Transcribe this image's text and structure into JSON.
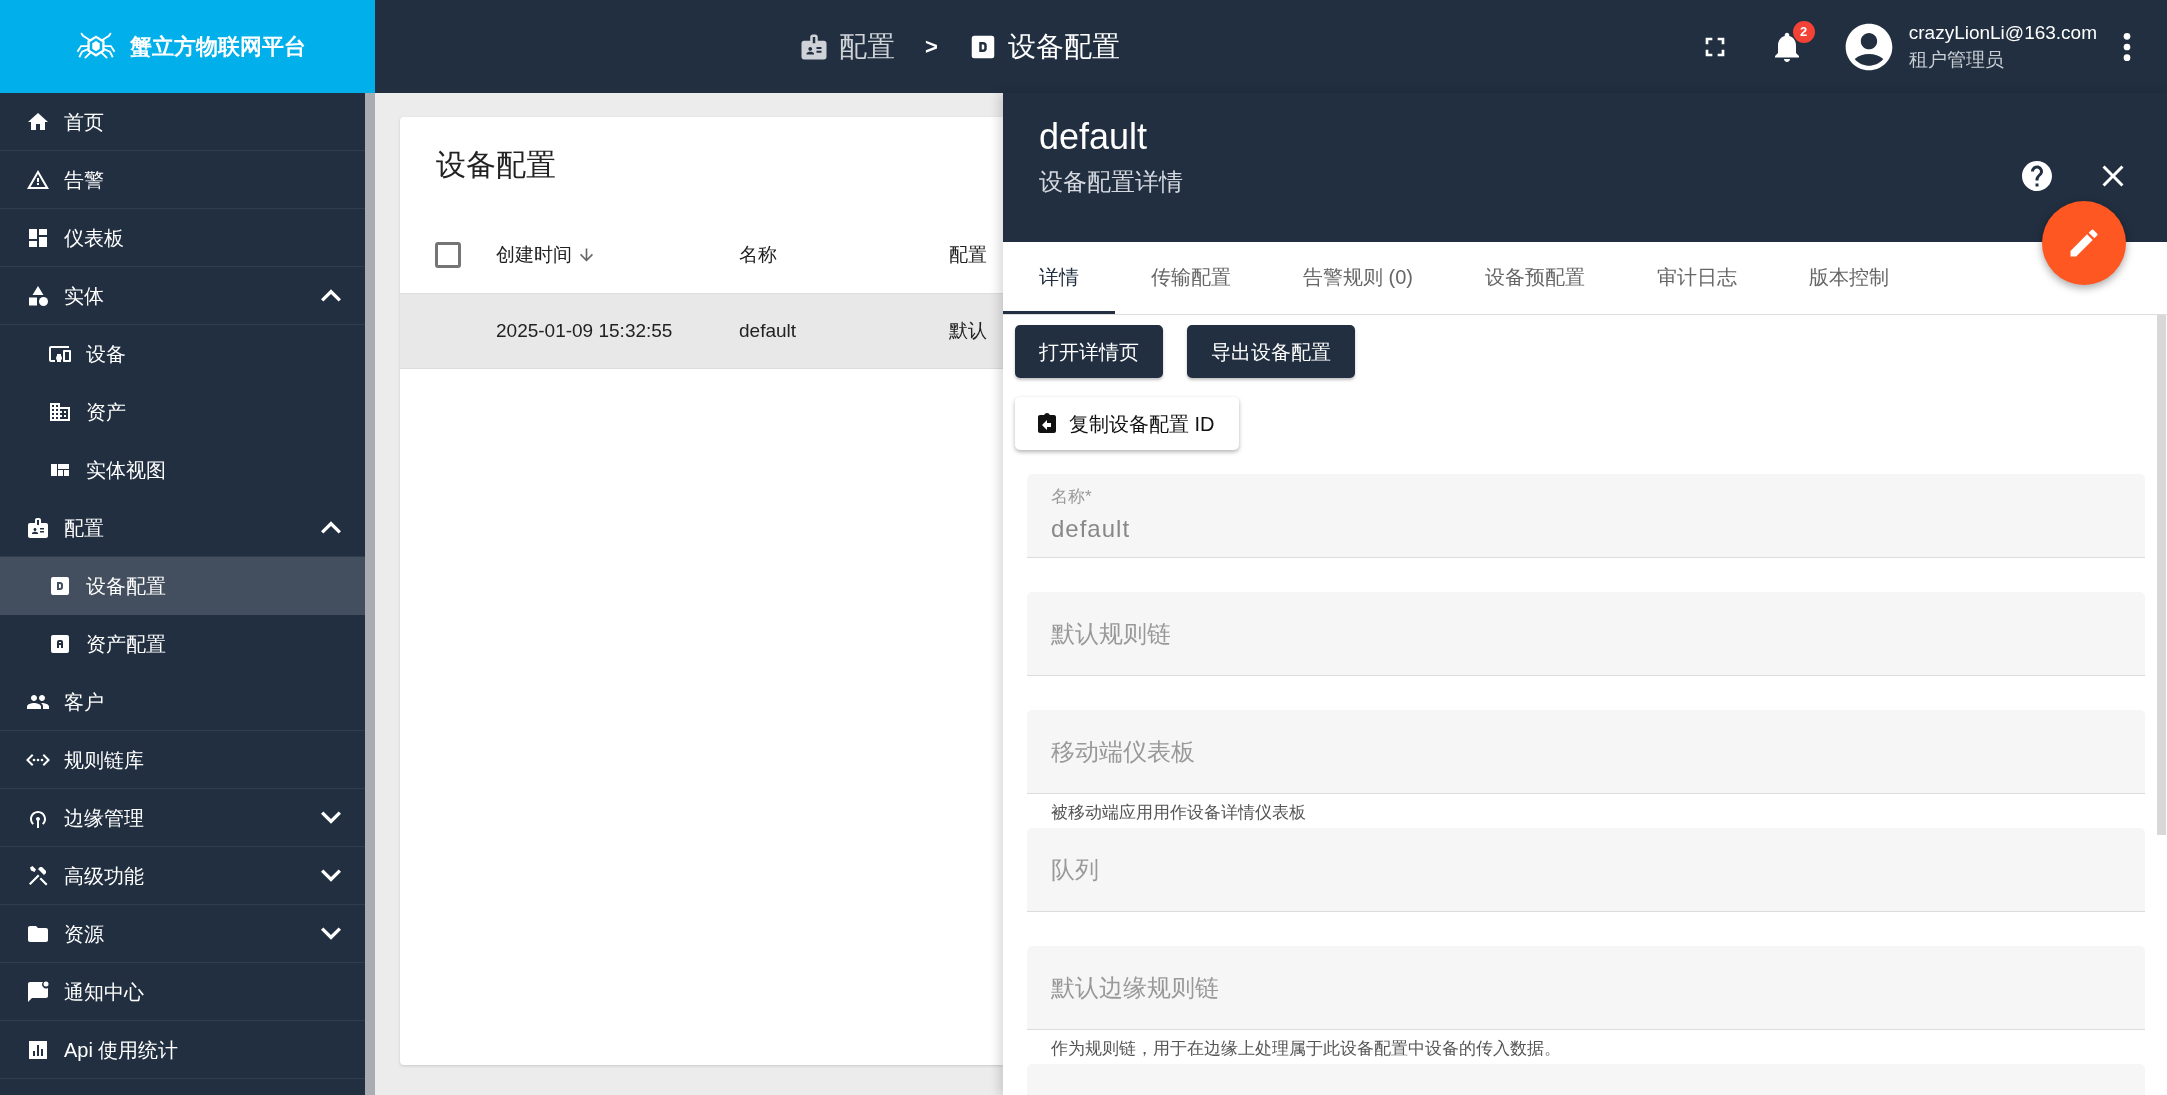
{
  "header": {
    "logo_text": "蟹立方物联网平台",
    "breadcrumb": [
      "配置",
      "设备配置"
    ],
    "breadcrumb_separator": ">",
    "notification_count": "2",
    "user": {
      "email": "crazyLionLi@163.com",
      "role": "租户管理员"
    }
  },
  "sidebar": {
    "items": [
      {
        "label": "首页",
        "selected": false
      },
      {
        "label": "告警",
        "selected": false
      },
      {
        "label": "仪表板",
        "selected": false
      },
      {
        "label": "实体",
        "selected": false,
        "expanded": true,
        "children": [
          {
            "label": "设备",
            "selected": false
          },
          {
            "label": "资产",
            "selected": false
          },
          {
            "label": "实体视图",
            "selected": false
          }
        ]
      },
      {
        "label": "配置",
        "selected": false,
        "expanded": true,
        "children": [
          {
            "label": "设备配置",
            "selected": true
          },
          {
            "label": "资产配置",
            "selected": false
          }
        ]
      },
      {
        "label": "客户",
        "selected": false
      },
      {
        "label": "规则链库",
        "selected": false
      },
      {
        "label": "边缘管理",
        "selected": false,
        "expanded": false
      },
      {
        "label": "高级功能",
        "selected": false,
        "expanded": false
      },
      {
        "label": "资源",
        "selected": false,
        "expanded": false
      },
      {
        "label": "通知中心",
        "selected": false
      },
      {
        "label": "Api 使用统计",
        "selected": false
      }
    ]
  },
  "table": {
    "title": "设备配置",
    "select_all_checked": false,
    "columns": [
      {
        "label": "创建时间",
        "sorted": true
      },
      {
        "label": "名称",
        "sorted": false
      },
      {
        "label": "配置",
        "sorted": false
      }
    ],
    "rows": [
      {
        "cells": [
          "2025-01-09 15:32:55",
          "default",
          "默认"
        ],
        "selected": true
      }
    ]
  },
  "detail_panel": {
    "title": "default",
    "subtitle": "设备配置详情",
    "tabs": [
      {
        "label": "详情",
        "selected": true
      },
      {
        "label": "传输配置",
        "selected": false
      },
      {
        "label": "告警规则 (0)",
        "selected": false
      },
      {
        "label": "设备预配置",
        "selected": false
      },
      {
        "label": "审计日志",
        "selected": false
      },
      {
        "label": "版本控制",
        "selected": false
      }
    ],
    "actions": [
      "打开详情页",
      "导出设备配置"
    ],
    "copy_button": "复制设备配置 ID",
    "fields": [
      {
        "label": "名称*",
        "value": "default"
      },
      {
        "placeholder": "默认规则链"
      },
      {
        "placeholder": "移动端仪表板",
        "hint": "被移动端应用用作设备详情仪表板"
      },
      {
        "placeholder": "队列"
      },
      {
        "placeholder": "默认边缘规则链",
        "hint": "作为规则链，用于在边缘上处理属于此设备配置中设备的传入数据。"
      }
    ]
  }
}
